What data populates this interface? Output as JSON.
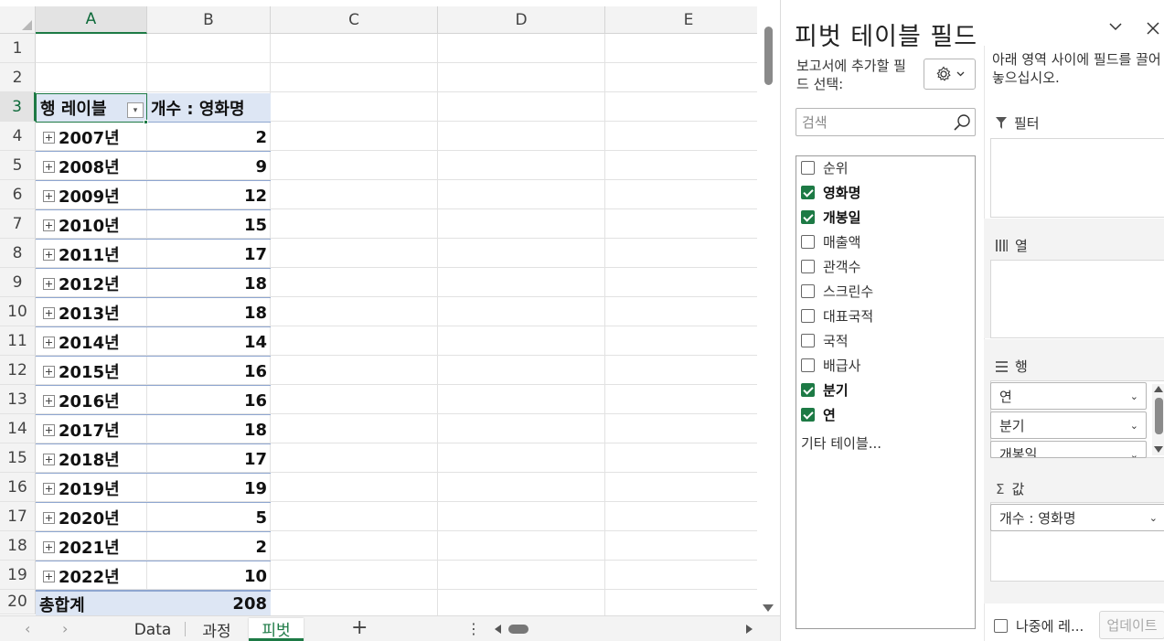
{
  "sheet": {
    "columns": [
      "A",
      "B",
      "C",
      "D",
      "E"
    ],
    "rows": [
      "1",
      "2",
      "3",
      "4",
      "5",
      "6",
      "7",
      "8",
      "9",
      "10",
      "11",
      "12",
      "13",
      "14",
      "15",
      "16",
      "17",
      "18",
      "19",
      "20"
    ],
    "pivot": {
      "row_label_header": "행 레이블",
      "value_header": "개수 : 영화명",
      "items": [
        {
          "label": "2007년",
          "value": "2"
        },
        {
          "label": "2008년",
          "value": "9"
        },
        {
          "label": "2009년",
          "value": "12"
        },
        {
          "label": "2010년",
          "value": "15"
        },
        {
          "label": "2011년",
          "value": "17"
        },
        {
          "label": "2012년",
          "value": "18"
        },
        {
          "label": "2013년",
          "value": "18"
        },
        {
          "label": "2014년",
          "value": "14"
        },
        {
          "label": "2015년",
          "value": "16"
        },
        {
          "label": "2016년",
          "value": "16"
        },
        {
          "label": "2017년",
          "value": "18"
        },
        {
          "label": "2018년",
          "value": "17"
        },
        {
          "label": "2019년",
          "value": "19"
        },
        {
          "label": "2020년",
          "value": "5"
        },
        {
          "label": "2021년",
          "value": "2"
        },
        {
          "label": "2022년",
          "value": "10"
        }
      ],
      "total_label": "총합계",
      "total_value": "208"
    }
  },
  "tabs": {
    "nav_prev": "‹",
    "nav_next": "›",
    "items": [
      {
        "label": "Data",
        "active": false
      },
      {
        "label": "과정",
        "active": false
      },
      {
        "label": "피벗",
        "active": true
      }
    ],
    "add": "+",
    "more": "⋮"
  },
  "pane": {
    "title": "피벗 테이블 필드",
    "choose_label": "보고서에 추가할 필드 선택:",
    "search_placeholder": "검색",
    "fields": [
      {
        "label": "순위",
        "checked": false
      },
      {
        "label": "영화명",
        "checked": true
      },
      {
        "label": "개봉일",
        "checked": true
      },
      {
        "label": "매출액",
        "checked": false
      },
      {
        "label": "관객수",
        "checked": false
      },
      {
        "label": "스크린수",
        "checked": false
      },
      {
        "label": "대표국적",
        "checked": false
      },
      {
        "label": "국적",
        "checked": false
      },
      {
        "label": "배급사",
        "checked": false
      },
      {
        "label": "분기",
        "checked": true
      },
      {
        "label": "연",
        "checked": true
      }
    ],
    "more_tables": "기타 테이블...",
    "drag_hint": "아래 영역 사이에 필드를 끌어 놓으십시오.",
    "areas": {
      "filter": {
        "label": "필터",
        "icon": "filter-icon"
      },
      "columns": {
        "label": "열",
        "icon": "columns-icon"
      },
      "rows": {
        "label": "행",
        "icon": "rows-icon",
        "items": [
          "연",
          "분기",
          "개봉일"
        ]
      },
      "values": {
        "label": "값",
        "icon": "sigma-icon",
        "items": [
          "개수 : 영화명"
        ]
      }
    },
    "defer_label": "나중에 레...",
    "update_label": "업데이트"
  },
  "colors": {
    "accent": "#1d7a45",
    "pivot_header_bg": "#dde6f4",
    "pivot_line": "#8ea6d0"
  }
}
